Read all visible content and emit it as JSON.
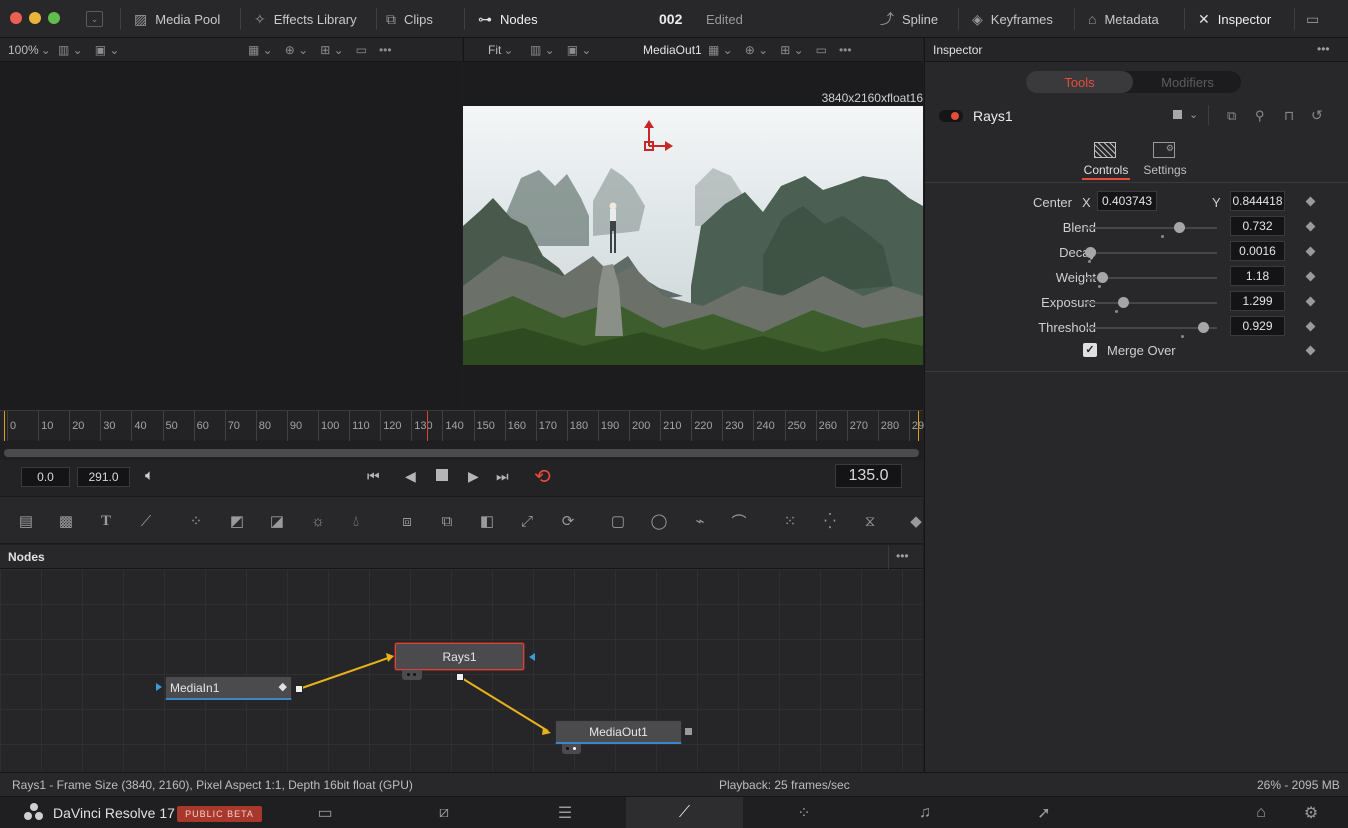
{
  "topbar": {
    "media_pool": "Media Pool",
    "effects_library": "Effects Library",
    "clips": "Clips",
    "nodes": "Nodes",
    "project_number": "002",
    "project_state": "Edited",
    "spline": "Spline",
    "keyframes": "Keyframes",
    "metadata": "Metadata",
    "inspector": "Inspector"
  },
  "viewer_left": {
    "zoom": "100%"
  },
  "viewer_right": {
    "fit": "Fit",
    "output_name": "MediaOut1",
    "resolution": "3840x2160xfloat16"
  },
  "timeline": {
    "ticks": [
      "0",
      "10",
      "20",
      "30",
      "40",
      "50",
      "60",
      "70",
      "80",
      "90",
      "100",
      "110",
      "120",
      "130",
      "140",
      "150",
      "160",
      "170",
      "180",
      "190",
      "200",
      "210",
      "220",
      "230",
      "240",
      "250",
      "260",
      "270",
      "280",
      "29"
    ],
    "playhead_frame": 135
  },
  "transport": {
    "start": "0.0",
    "end": "291.0",
    "current": "135.0"
  },
  "nodes_panel": {
    "title": "Nodes",
    "nodes": [
      {
        "name": "MediaIn1"
      },
      {
        "name": "Rays1"
      },
      {
        "name": "MediaOut1"
      }
    ]
  },
  "inspector": {
    "title": "Inspector",
    "tabs": {
      "tools": "Tools",
      "modifiers": "Modifiers"
    },
    "tool_name": "Rays1",
    "subtabs": {
      "controls": "Controls",
      "settings": "Settings"
    },
    "center": {
      "label": "Center",
      "x_label": "X",
      "x_value": "0.403743",
      "y_label": "Y",
      "y_value": "0.844418"
    },
    "params": [
      {
        "label": "Blend",
        "value": "0.732",
        "fraction": 0.73
      },
      {
        "label": "Decay",
        "value": "0.0016",
        "fraction": 0.0
      },
      {
        "label": "Weight",
        "value": "1.18",
        "fraction": 0.1
      },
      {
        "label": "Exposure",
        "value": "1.299",
        "fraction": 0.27
      },
      {
        "label": "Threshold",
        "value": "0.929",
        "fraction": 0.93
      }
    ],
    "merge_over": {
      "label": "Merge Over",
      "checked": true
    }
  },
  "statusbar": {
    "info": "Rays1 - Frame Size (3840, 2160), Pixel Aspect 1:1, Depth 16bit float (GPU)",
    "playback": "Playback: 25 frames/sec",
    "memory": "26% - 2095 MB"
  },
  "bottombar": {
    "app_name": "DaVinci Resolve 17",
    "badge": "PUBLIC BETA"
  },
  "colors": {
    "accent_red": "#e64b3c",
    "wire_yellow": "#e8b21a",
    "badge": "#a8372c",
    "selected_red": "#d8443a"
  }
}
